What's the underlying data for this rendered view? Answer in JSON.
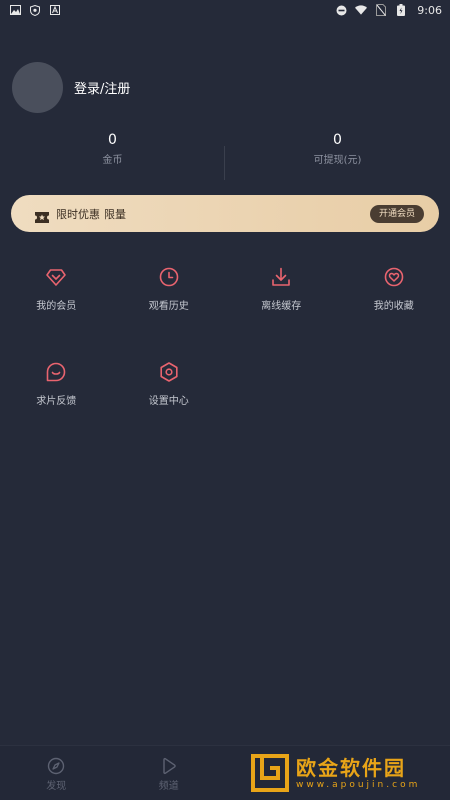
{
  "status_bar": {
    "time": "9:06",
    "left_icons": [
      "image-icon",
      "shield-icon",
      "a-icon"
    ],
    "right_icons": [
      "do-not-disturb-icon",
      "wifi-icon",
      "no-sim-icon",
      "battery-icon"
    ]
  },
  "profile": {
    "login_label": "登录/注册"
  },
  "stats": [
    {
      "value": "0",
      "label": "金币"
    },
    {
      "value": "0",
      "label": "可提现(元)"
    }
  ],
  "vip_banner": {
    "icon": "ticket-icon",
    "text": "限时优惠",
    "text2": "限量",
    "button_label": "开通会员"
  },
  "grid": [
    {
      "label": "我的会员",
      "icon": "diamond-icon"
    },
    {
      "label": "观看历史",
      "icon": "clock-icon"
    },
    {
      "label": "离线缓存",
      "icon": "download-icon"
    },
    {
      "label": "我的收藏",
      "icon": "heart-icon"
    },
    {
      "label": "求片反馈",
      "icon": "chat-bubble-icon"
    },
    {
      "label": "设置中心",
      "icon": "settings-hexagon-icon"
    }
  ],
  "bottom_nav": [
    {
      "label": "发现",
      "icon": "compass-icon"
    },
    {
      "label": "频道",
      "icon": "play-icon"
    }
  ],
  "watermark": {
    "text": "欧金软件园",
    "sub": "www.apoujin.com"
  },
  "colors": {
    "background": "#252a39",
    "accent": "#e9646f",
    "vip_gradient_start": "#efdcc0",
    "vip_gradient_end": "#e8cda6",
    "vip_button": "#4a3d32",
    "watermark": "#e8a418"
  }
}
